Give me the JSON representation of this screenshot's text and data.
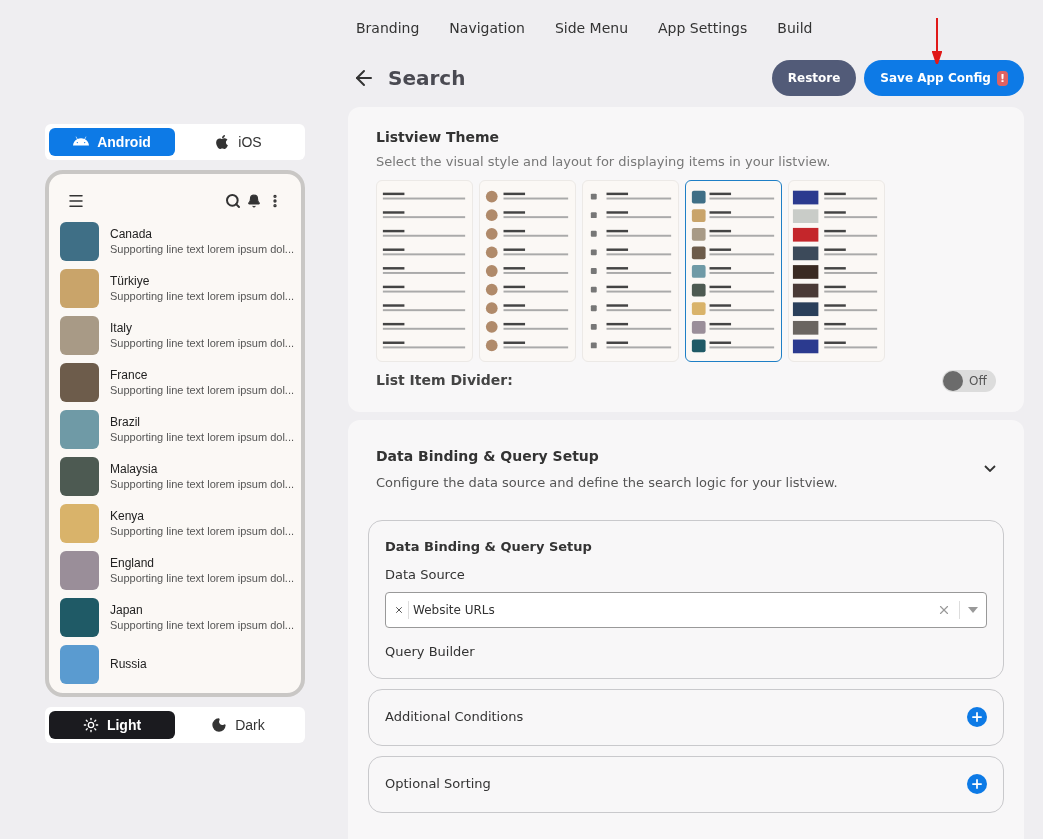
{
  "nav_tabs": [
    {
      "label": "Branding"
    },
    {
      "label": "Navigation"
    },
    {
      "label": "Side Menu"
    },
    {
      "label": "App Settings"
    },
    {
      "label": "Build"
    }
  ],
  "header": {
    "title": "Search",
    "buttons": [
      {
        "kind": "secondary",
        "label": "Restore"
      },
      {
        "kind": "primary",
        "label": "Save App Config",
        "badge": "!"
      }
    ]
  },
  "platform_tabs": [
    {
      "label": "Android",
      "kind": "android",
      "selected": true
    },
    {
      "label": "iOS",
      "kind": "ios",
      "selected": false
    }
  ],
  "phone_preview": {
    "items": [
      {
        "title": "Canada",
        "subtitle": "Supporting line text lorem ipsum dol...",
        "color": "#3f6f86"
      },
      {
        "title": "Türkiye",
        "subtitle": "Supporting line text lorem ipsum dol...",
        "color": "#c9a46a"
      },
      {
        "title": "Italy",
        "subtitle": "Supporting line text lorem ipsum dol...",
        "color": "#a89a86"
      },
      {
        "title": "France",
        "subtitle": "Supporting line text lorem ipsum dol...",
        "color": "#6d5c4b"
      },
      {
        "title": "Brazil",
        "subtitle": "Supporting line text lorem ipsum dol...",
        "color": "#6f9aa6"
      },
      {
        "title": "Malaysia",
        "subtitle": "Supporting line text lorem ipsum dol...",
        "color": "#4d5a52"
      },
      {
        "title": "Kenya",
        "subtitle": "Supporting line text lorem ipsum dol...",
        "color": "#d9b36a"
      },
      {
        "title": "England",
        "subtitle": "Supporting line text lorem ipsum dol...",
        "color": "#9a8e99"
      },
      {
        "title": "Japan",
        "subtitle": "Supporting line text lorem ipsum dol...",
        "color": "#1f5a66"
      },
      {
        "title": "Russia",
        "color": "#5a9bd0"
      }
    ]
  },
  "theme_tabs": [
    {
      "label": "Light",
      "kind": "light",
      "selected": true
    },
    {
      "label": "Dark",
      "kind": "dark",
      "selected": false
    }
  ],
  "listview_theme": {
    "title": "Listview Theme",
    "description": "Select the visual style and layout for displaying items in your listview.",
    "options": [
      {
        "kind": "text",
        "selected": false
      },
      {
        "kind": "avatar",
        "selected": false
      },
      {
        "kind": "icon",
        "selected": false
      },
      {
        "kind": "image",
        "selected": true
      },
      {
        "kind": "video",
        "selected": false
      }
    ],
    "divider": {
      "label": "List Item Divider:",
      "on": false,
      "state_label": "Off"
    }
  },
  "data_binding": {
    "title": "Data Binding & Query Setup",
    "description": "Configure the data source and define the search logic for your listview.",
    "expanded": true,
    "panel": {
      "title": "Data Binding & Query Setup",
      "data_source_label": "Data Source",
      "chips": [
        "Website URLs"
      ],
      "query_builder_label": "Query Builder"
    },
    "sections": [
      {
        "label": "Additional Conditions"
      },
      {
        "label": "Optional Sorting"
      }
    ]
  }
}
